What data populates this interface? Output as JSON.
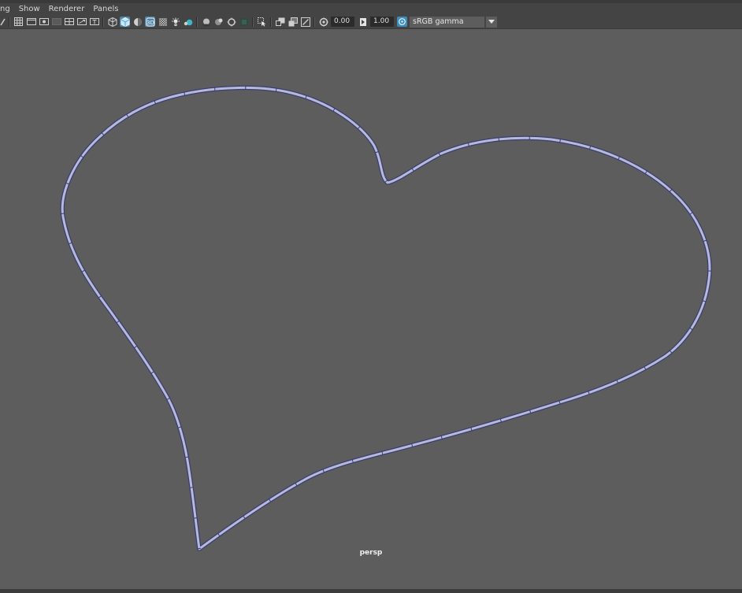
{
  "menu": {
    "items": [
      {
        "label": "ng"
      },
      {
        "label": "Show"
      },
      {
        "label": "Renderer"
      },
      {
        "label": "Panels"
      }
    ]
  },
  "toolbar": {
    "exposure_value": "0.00",
    "gamma_value": "1.00",
    "color_space": "sRGB gamma",
    "icons": [
      "select-camera-icon",
      "grid-icon",
      "film-gate-icon",
      "resolution-gate-icon",
      "gate-mask-icon",
      "field-chart-icon",
      "safe-action-icon",
      "safe-title-icon",
      "wireframe-icon",
      "smooth-shade-icon",
      "default-material-icon",
      "xray-joints-icon",
      "use-all-lights-icon",
      "shadows-icon",
      "screen-space-ao-icon",
      "motion-blur-icon",
      "antialiasing-icon",
      "depth-of-field-icon",
      "isolate-select-icon",
      "xray-icon",
      "xray-active-icon",
      "backface-icon",
      "exposure-icon",
      "gamma-icon",
      "color-management-icon"
    ]
  },
  "viewport": {
    "camera": "persp",
    "background_color": "#5d5d5d",
    "curve_color": "#b6b9dc",
    "curve_outline_color": "#3a3e6e"
  }
}
